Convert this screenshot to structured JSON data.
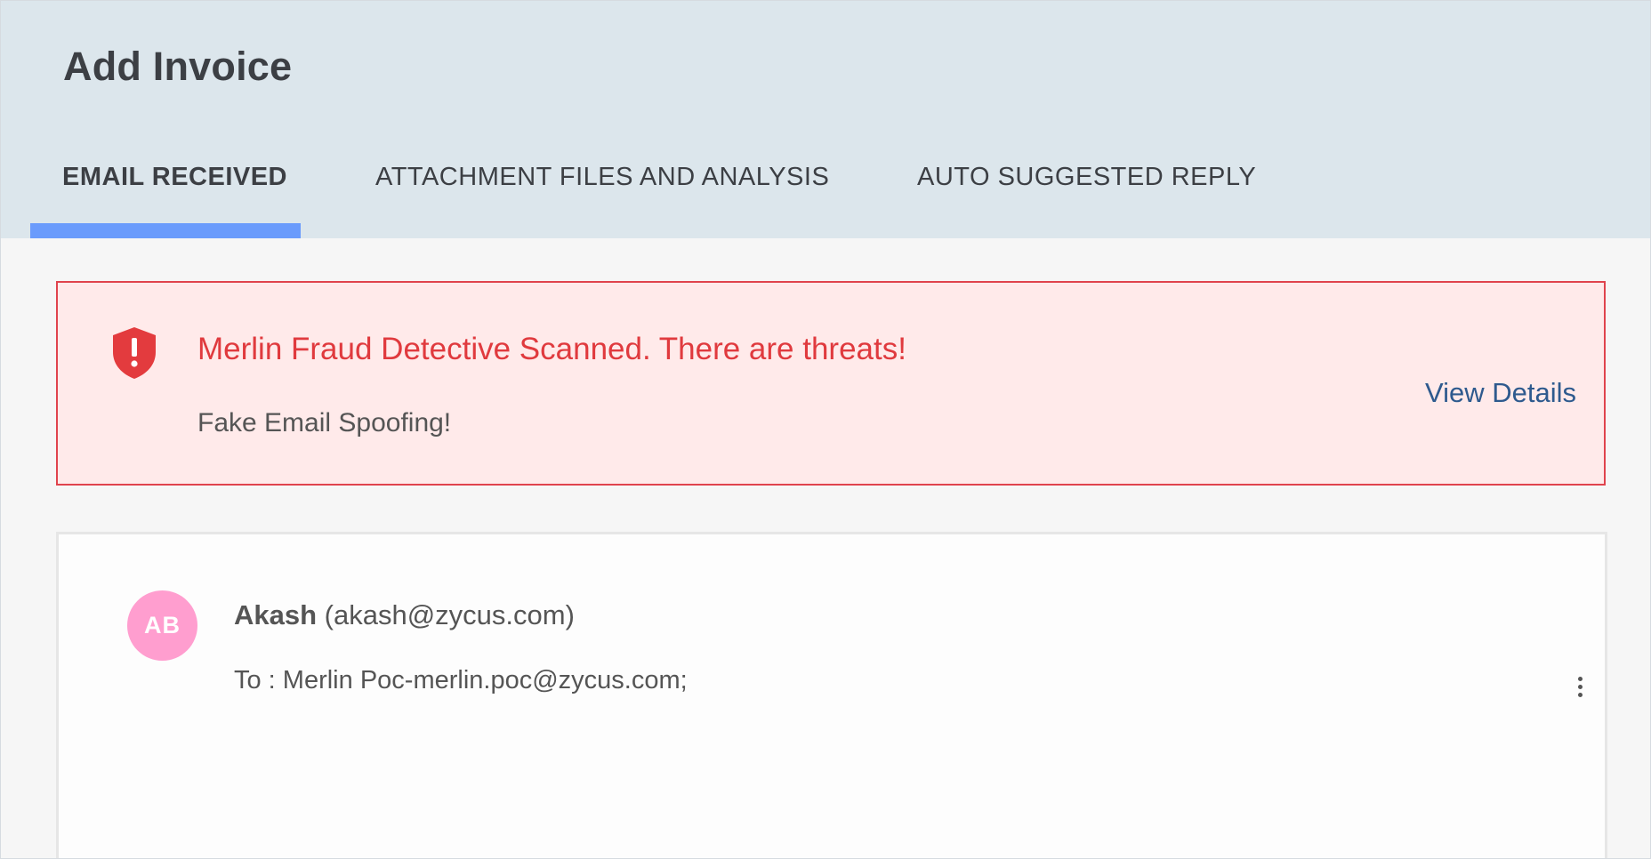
{
  "page": {
    "title": "Add Invoice"
  },
  "tabs": [
    {
      "label": "EMAIL RECEIVED",
      "active": true
    },
    {
      "label": "ATTACHMENT FILES AND ANALYSIS",
      "active": false
    },
    {
      "label": "AUTO SUGGESTED REPLY",
      "active": false
    }
  ],
  "alert": {
    "icon": "shield-alert-icon",
    "title": "Merlin Fraud Detective Scanned. There are threats!",
    "detail": "Fake Email Spoofing!",
    "action_label": "View Details"
  },
  "email": {
    "avatar_initials": "AB",
    "sender_name": "Akash",
    "sender_email": "(akash@zycus.com)",
    "recipients": "To : Merlin Poc-merlin.poc@zycus.com;",
    "menu_icon": "more-vertical-icon"
  },
  "colors": {
    "header_bg": "#dce6ec",
    "tab_accent": "#6a9bfc",
    "alert_bg": "#ffeaea",
    "alert_border": "#e0434d",
    "alert_text": "#e03a3e",
    "link": "#2e5a8e",
    "avatar_bg": "#ff9ecf"
  }
}
